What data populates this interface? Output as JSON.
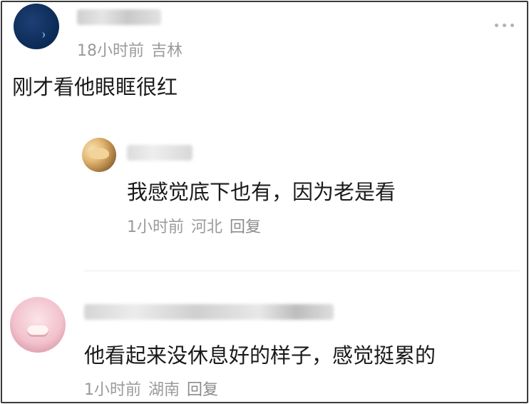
{
  "post": {
    "author": {
      "avatar": "avatar-dark-blue"
    },
    "time": "18小时前",
    "location": "吉林",
    "text": "刚才看他眼眶很红",
    "more_icon": "more-dots-icon"
  },
  "replies": [
    {
      "avatar": "avatar-food-photo",
      "text": "我感觉底下也有，因为老是看",
      "time": "1小时前",
      "location": "河北",
      "reply_label": "回复"
    },
    {
      "avatar": "avatar-pink-photo",
      "text": "他看起来没休息好的样子，感觉挺累的",
      "time": "1小时前",
      "location": "湖南",
      "reply_label": "回复"
    }
  ],
  "colors": {
    "meta_text": "#9a9a9a",
    "body_text": "#1a1a1a",
    "avatar_blue": "#0b2a55"
  }
}
